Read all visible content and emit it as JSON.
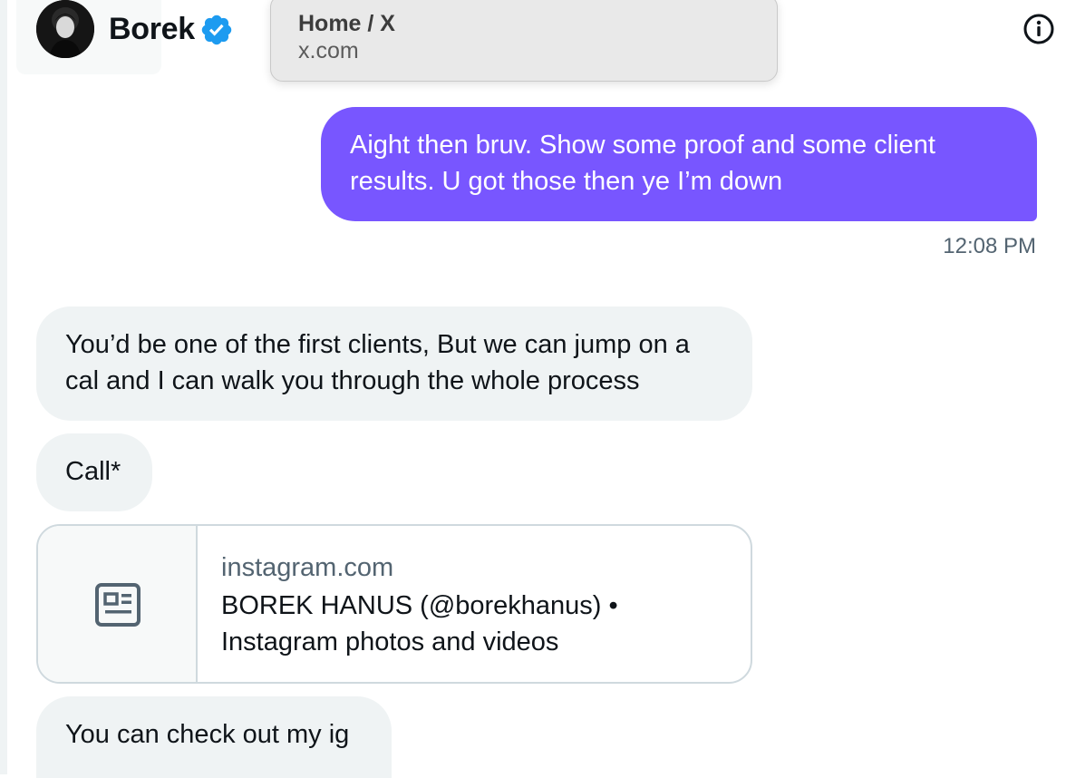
{
  "header": {
    "display_name": "Borek"
  },
  "popover": {
    "title": "Home / X",
    "url": "x.com"
  },
  "messages": [
    {
      "direction": "sent",
      "text": "Aight then bruv. Show some proof and some client results. U got those then ye I’m down",
      "time": "12:08 PM"
    },
    {
      "direction": "received",
      "text": "You’d be one of the first clients, But we can jump on a cal and I can walk you through the whole process"
    },
    {
      "direction": "received",
      "text": "Call*"
    },
    {
      "direction": "received",
      "type": "link-card",
      "domain": "instagram.com",
      "title": "BOREK HANUS (@borekhanus) • Instagram photos and videos"
    },
    {
      "direction": "received",
      "text": "You can check out my ig"
    }
  ],
  "colors": {
    "sent_bubble": "#7856ff",
    "received_bubble": "#eff3f4",
    "verified_badge": "#1d9bf0",
    "secondary_text": "#536471",
    "card_border": "#cfd9de"
  },
  "icons": {
    "verified": "verified-badge-icon",
    "info": "info-icon",
    "link_card": "article-icon"
  }
}
